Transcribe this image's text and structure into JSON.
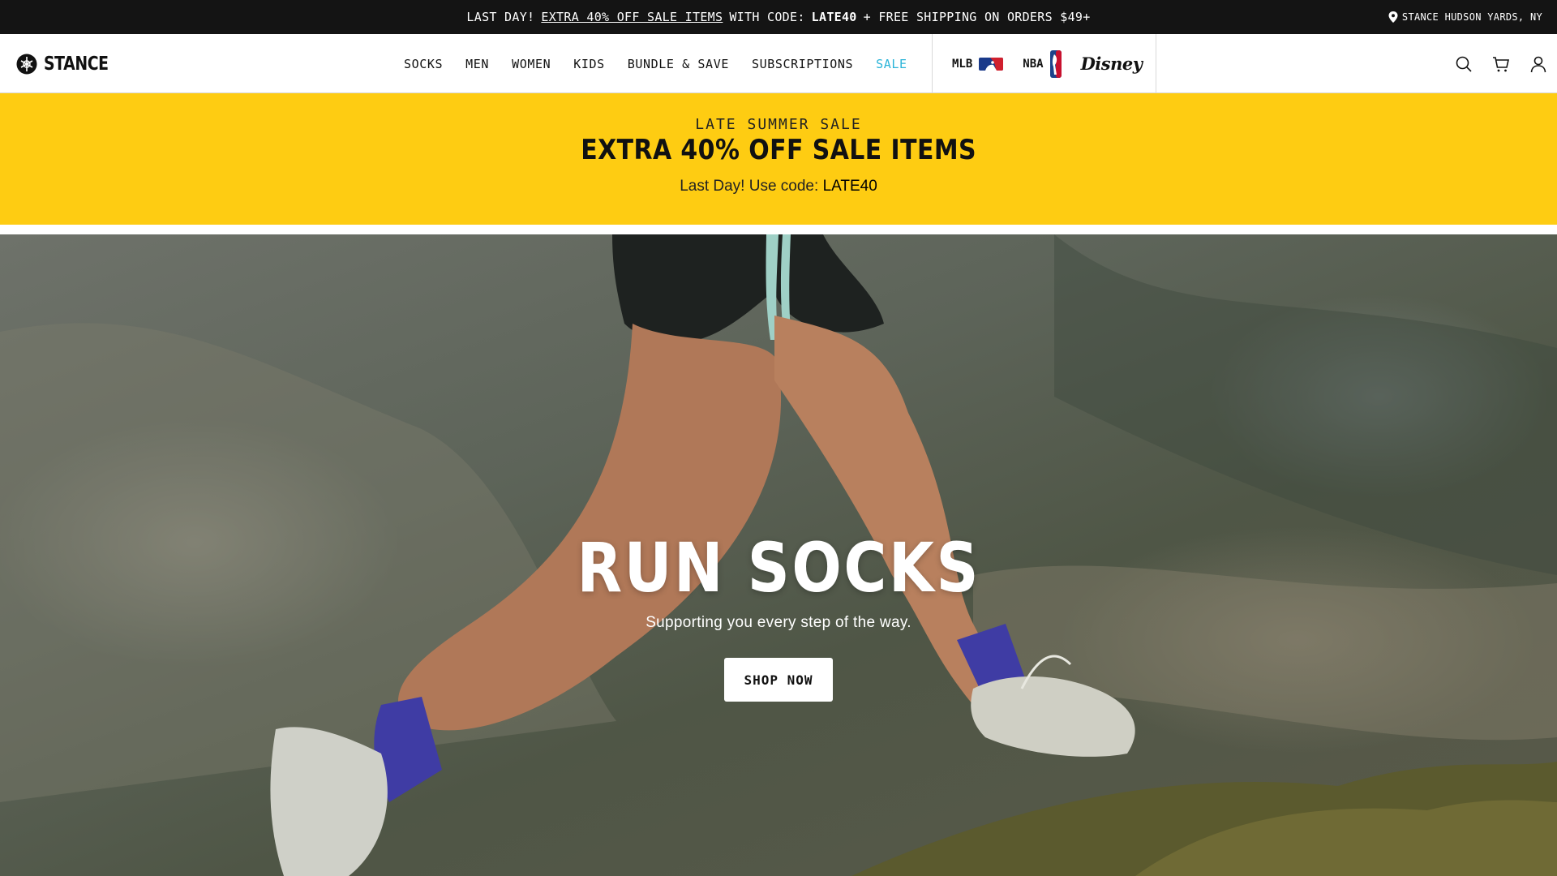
{
  "announcement": {
    "prefix": "LAST DAY!",
    "link": "EXTRA 40% OFF SALE ITEMS",
    "middle": "WITH CODE:",
    "code": "LATE40",
    "suffix": "+ FREE SHIPPING ON ORDERS $49+",
    "store": "STANCE HUDSON YARDS, NY"
  },
  "header": {
    "logo": "STANCE",
    "nav": [
      "SOCKS",
      "MEN",
      "WOMEN",
      "KIDS",
      "BUNDLE & SAVE",
      "SUBSCRIPTIONS",
      "SALE"
    ],
    "licenses": {
      "mlb": "MLB",
      "nba": "NBA",
      "disney": "Disney"
    }
  },
  "promo": {
    "eyebrow": "LATE SUMMER SALE",
    "title": "EXTRA 40% OFF SALE ITEMS",
    "sub_prefix": "Last Day! Use code:",
    "sub_code": "LATE40"
  },
  "hero": {
    "title": "RUN SOCKS",
    "subtitle": "Supporting you every step of the way.",
    "cta": "SHOP NOW"
  },
  "colors": {
    "announcement_bg": "#141414",
    "promo_bg": "#fecc12",
    "sale_link": "#2ab4d8",
    "sock": "#3f3ca4"
  },
  "icons": [
    "location-pin-icon",
    "stance-logo-icon",
    "mlb-logo-icon",
    "nba-logo-icon",
    "search-icon",
    "cart-icon",
    "account-icon"
  ]
}
